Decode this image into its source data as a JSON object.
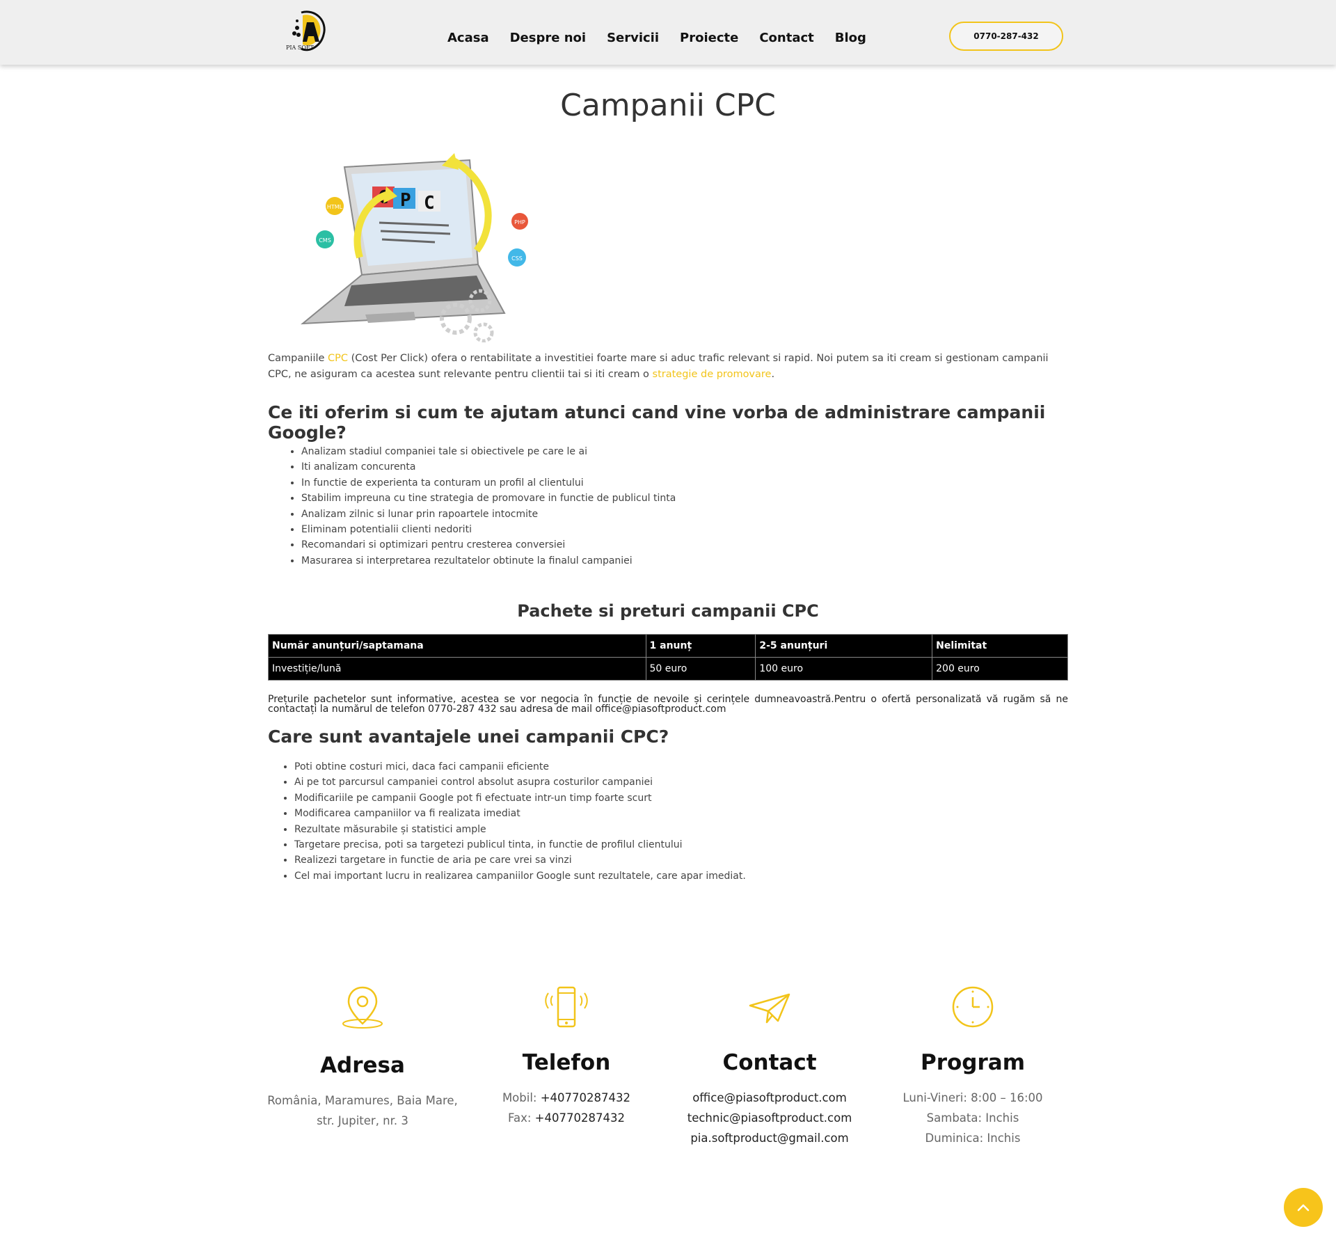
{
  "header": {
    "logo_text": "PIA SOFT",
    "nav": [
      "Acasa",
      "Despre noi",
      "Servicii",
      "Proiecte",
      "Contact",
      "Blog"
    ],
    "phone": "0770-287-432"
  },
  "page": {
    "title": "Campanii CPC",
    "hero_letters": [
      "C",
      "P",
      "C"
    ],
    "hero_badges": [
      "CMS",
      "CSS",
      "PHP",
      "HTML"
    ],
    "intro": {
      "part1": "Campaniile ",
      "cpc_link": "CPC",
      "part2": " (Cost Per Click) ofera o rentabilitate a investitiei foarte mare si aduc trafic relevant si rapid. Noi putem sa iti cream si gestionam campanii CPC, ne asiguram ca acestea sunt relevante pentru clientii tai si iti cream o ",
      "strategy_link": "strategie de promovare",
      "part3": "."
    },
    "offer_heading": "Ce iti oferim si cum te ajutam atunci cand vine vorba de administrare campanii Google?",
    "offer_items": [
      "Analizam stadiul companiei tale si obiectivele pe care le ai",
      "Iti analizam concurenta",
      "In functie de experienta ta conturam un profil al clientului",
      "Stabilim impreuna cu tine strategia de promovare in functie de publicul tinta",
      "Analizam zilnic si lunar prin rapoartele intocmite",
      "Eliminam potentialii clienti nedoriti",
      "Recomandari si optimizari pentru cresterea conversiei",
      "Masurarea si interpretarea rezultatelor obtinute la finalul campaniei"
    ],
    "packages_heading": "Pachete si preturi campanii CPC",
    "table": {
      "headers": [
        "Număr anunțuri/saptamana",
        "1 anunț",
        "2-5 anunțuri",
        "Nelimitat"
      ],
      "row": [
        "Investiție/lună",
        "50 euro",
        "100 euro",
        "200 euro"
      ]
    },
    "note": "Prețurile pachetelor sunt informative, acestea se vor negocia în funcție de nevoile și cerințele dumneavoastră.Pentru o ofertă personalizată vă rugăm să ne contactați la numărul de telefon 0770-287 432 sau adresa de mail office@piasoftproduct.com",
    "advantages_heading": "Care sunt avantajele unei campanii CPC?",
    "advantages_items": [
      "Poti obtine costuri mici, daca faci campanii eficiente",
      "Ai pe tot parcursul campaniei control absolut asupra costurilor campaniei",
      "Modificariile pe campanii Google pot fi efectuate intr-un timp foarte scurt",
      "Modificarea campaniilor va fi realizata imediat",
      "Rezultate măsurabile și statistici ample",
      "Targetare precisa, poti sa targetezi publicul tinta, in functie de profilul clientului",
      "Realizezi targetare in functie de aria pe care vrei sa vinzi",
      "Cel mai important lucru in realizarea campaniilor Google sunt rezultatele, care apar imediat."
    ]
  },
  "footer": {
    "address": {
      "title": "Adresa",
      "line1": "România, Maramures, Baia Mare,",
      "line2": "str. Jupiter, nr. 3",
      "icon": "location-pin-icon"
    },
    "phone": {
      "title": "Telefon",
      "mobile_label": "Mobil:",
      "mobile": "+40770287432",
      "fax_label": "Fax:",
      "fax": "+40770287432",
      "icon": "smartphone-icon"
    },
    "contact": {
      "title": "Contact",
      "emails": [
        "office@piasoftproduct.com",
        "technic@piasoftproduct.com",
        "pia.softproduct@gmail.com"
      ],
      "icon": "paper-plane-icon"
    },
    "schedule": {
      "title": "Program",
      "lines": [
        "Luni-Vineri: 8:00 – 16:00",
        "Sambata: Inchis",
        "Duminica: Inchis"
      ],
      "icon": "clock-icon"
    }
  },
  "colors": {
    "accent": "#f2c41a",
    "text": "#333333",
    "header_bg": "#efefef"
  }
}
